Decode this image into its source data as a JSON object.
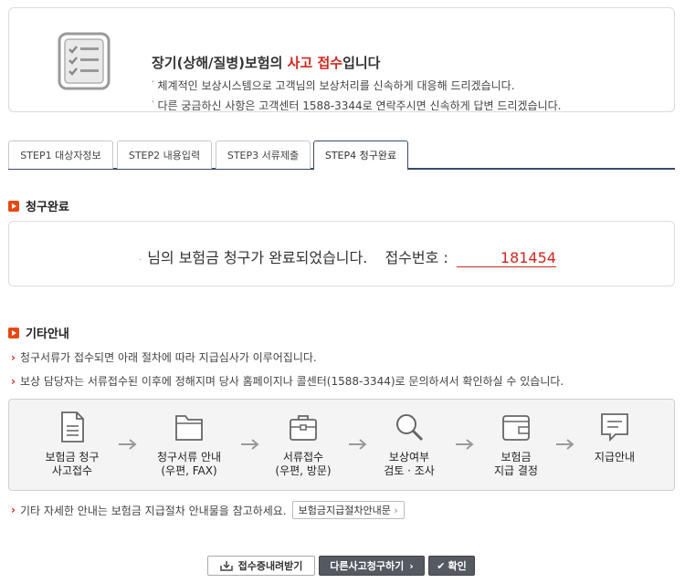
{
  "header": {
    "title_prefix": "장기(상해/질병)보험의 ",
    "title_highlight": "사고 접수",
    "title_suffix": "입니다",
    "line1": "체계적인 보상시스템으로 고객님의 보상처리를 신속하게 대응해 드리겠습니다.",
    "line2": "다른 궁금하신 사항은 고객센터 1588-3344로 연락주시면 신속하게 답변 드리겠습니다.",
    "icon": "checklist-icon"
  },
  "tabs": [
    {
      "label": "STEP1 대상자정보",
      "active": false
    },
    {
      "label": "STEP2 내용입력",
      "active": false
    },
    {
      "label": "STEP3 서류제출",
      "active": false
    },
    {
      "label": "STEP4 청구완료",
      "active": true
    }
  ],
  "complete_section": {
    "heading": "청구완료",
    "message": "님의 보험금 청구가 완료되었습니다.",
    "receipt_label": "접수번호 :",
    "receipt_number": "181454"
  },
  "info_section": {
    "heading": "기타안내",
    "line1": "청구서류가 접수되면 아래 절차에 따라 지급심사가 이루어집니다.",
    "line2": "보상 담당자는 서류접수된 이후에 정해지며 당사 홈페이지나 콜센터(1588-3344)로 문의하셔서 확인하실 수 있습니다.",
    "steps": [
      {
        "line1": "보험금 청구",
        "line2": "사고접수",
        "icon": "document-icon"
      },
      {
        "line1": "청구서류 안내",
        "line2": "(우편, FAX)",
        "icon": "folder-icon"
      },
      {
        "line1": "서류접수",
        "line2": "(우편, 방문)",
        "icon": "briefcase-icon"
      },
      {
        "line1": "보상여부",
        "line2": "검토 · 조사",
        "icon": "magnifier-icon"
      },
      {
        "line1": "보험금",
        "line2": "지급 결정",
        "icon": "wallet-icon"
      },
      {
        "line1": "지급안내",
        "line2": "",
        "icon": "message-icon"
      }
    ],
    "note": "기타 자세한 안내는 보험금 지급절차 안내물을 참고하세요.",
    "guide_button": "보험금지급절차안내문"
  },
  "buttons": {
    "download": "접수증내려받기",
    "other_claim": "다른사고청구하기",
    "confirm": "확인"
  },
  "colors": {
    "accent_red": "#d0261e",
    "bullet_orange": "#e8470f",
    "tab_navy": "#3b4a6b",
    "dark_button": "#555a62"
  }
}
